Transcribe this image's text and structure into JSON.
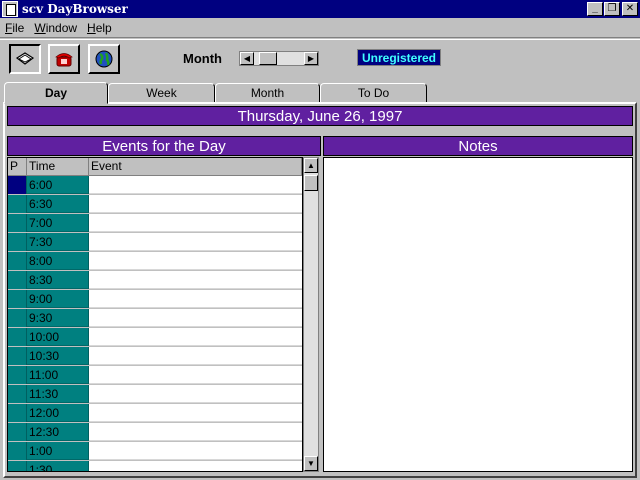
{
  "window": {
    "title": "scv DayBrowser"
  },
  "menu": [
    {
      "label": "File",
      "accel": "F",
      "rest": "ile"
    },
    {
      "label": "Window",
      "accel": "W",
      "rest": "indow"
    },
    {
      "label": "Help",
      "accel": "H",
      "rest": "elp"
    }
  ],
  "toolbar": {
    "buttons": [
      {
        "name": "book-icon"
      },
      {
        "name": "phone-icon"
      },
      {
        "name": "globe-icon"
      }
    ],
    "month_label": "Month",
    "registration": "Unregistered"
  },
  "tabs": [
    {
      "label": "Day",
      "active": true
    },
    {
      "label": "Week",
      "active": false
    },
    {
      "label": "Month",
      "active": false
    },
    {
      "label": "To Do",
      "active": false
    }
  ],
  "day": {
    "date": "Thursday, June 26, 1997",
    "events_title": "Events for the Day",
    "notes_title": "Notes",
    "columns": {
      "p": "P",
      "time": "Time",
      "event": "Event"
    },
    "times": [
      "6:00",
      "6:30",
      "7:00",
      "7:30",
      "8:00",
      "8:30",
      "9:00",
      "9:30",
      "10:00",
      "10:30",
      "11:00",
      "11:30",
      "12:00",
      "12:30",
      "1:00",
      "1:30"
    ]
  },
  "colors": {
    "header_purple": "#6020a0",
    "time_teal": "#008080",
    "title_navy": "#000080",
    "registration_cyan": "#40ffff"
  }
}
